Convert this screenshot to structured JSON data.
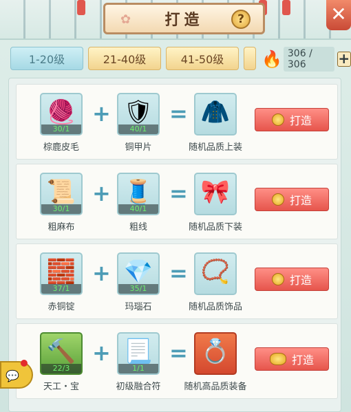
{
  "header": {
    "title": "打造",
    "help_label": "?",
    "close_label": "✕"
  },
  "tabs": [
    {
      "label": "1-20级",
      "active": true
    },
    {
      "label": "21-40级",
      "active": false
    },
    {
      "label": "41-50级",
      "active": false
    },
    {
      "label": "",
      "active": false
    }
  ],
  "energy": {
    "value": "306 / 306",
    "plus_label": "+"
  },
  "recipes": [
    {
      "material1": {
        "name": "棕鹿皮毛",
        "count": "30/1",
        "icon": "fur-icon"
      },
      "material2": {
        "name": "铜甲片",
        "count": "40/1",
        "icon": "copper-plate-icon"
      },
      "result": {
        "name": "随机品质上装",
        "icon": "upper-garment-icon"
      },
      "button_label": "打造"
    },
    {
      "material1": {
        "name": "粗麻布",
        "count": "30/1",
        "icon": "linen-cloth-icon"
      },
      "material2": {
        "name": "粗线",
        "count": "40/1",
        "icon": "thread-spool-icon"
      },
      "result": {
        "name": "随机品质下装",
        "icon": "belt-icon"
      },
      "button_label": "打造"
    },
    {
      "material1": {
        "name": "赤铜锭",
        "count": "37/1",
        "icon": "copper-ingot-icon"
      },
      "material2": {
        "name": "玛瑙石",
        "count": "35/1",
        "icon": "agate-stone-icon"
      },
      "result": {
        "name": "随机品质饰品",
        "icon": "bead-necklace-icon"
      },
      "button_label": "打造"
    },
    {
      "material1": {
        "name": "天工・宝",
        "count": "22/3",
        "icon": "hammer-icon"
      },
      "material2": {
        "name": "初级融合符",
        "count": "1/1",
        "icon": "fusion-scroll-icon"
      },
      "result": {
        "name": "随机高品质装备",
        "icon": "gem-ring-icon"
      },
      "button_label": "打造"
    }
  ],
  "colors": {
    "forge_button": "#e6554c",
    "tab_active": "#a6d9e5",
    "tab_inactive": "#f2d48e",
    "count_text": "#6df06d"
  }
}
